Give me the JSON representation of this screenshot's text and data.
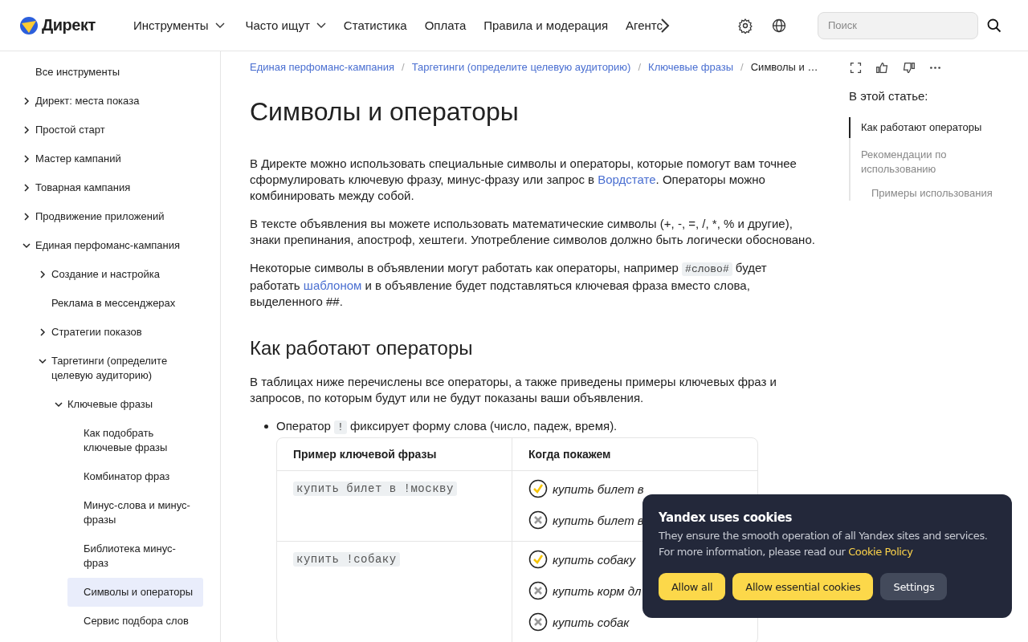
{
  "header": {
    "logo": "Директ",
    "nav": [
      {
        "label": "Инструменты",
        "dropdown": true
      },
      {
        "label": "Часто ищут",
        "dropdown": true
      },
      {
        "label": "Статистика",
        "dropdown": false
      },
      {
        "label": "Оплата",
        "dropdown": false
      },
      {
        "label": "Правила и модерация",
        "dropdown": false
      },
      {
        "label": "Агентс",
        "dropdown": false
      }
    ],
    "search": {
      "placeholder": "Поиск"
    }
  },
  "sidebar": {
    "items": [
      {
        "label": "Все инструменты",
        "kind": "page",
        "selected": false
      },
      {
        "label": "Директ: места показа",
        "kind": "folder",
        "expanded": false,
        "selected": false
      },
      {
        "label": "Простой старт",
        "kind": "folder",
        "expanded": false,
        "selected": false
      },
      {
        "label": "Мастер кампаний",
        "kind": "folder",
        "expanded": false,
        "selected": false
      },
      {
        "label": "Товарная кампания",
        "kind": "folder",
        "expanded": false,
        "selected": false
      },
      {
        "label": "Продвижение приложений",
        "kind": "folder",
        "expanded": false,
        "selected": false
      },
      {
        "label": "Единая перфоманс-кампания",
        "kind": "folder",
        "expanded": true,
        "selected": false,
        "children": [
          {
            "label": "Создание и настройка",
            "kind": "folder",
            "expanded": false,
            "selected": false
          },
          {
            "label": "Реклама в мессенджерах",
            "kind": "page",
            "selected": false
          },
          {
            "label": "Стратегии показов",
            "kind": "folder",
            "expanded": false,
            "selected": false
          },
          {
            "label": "Таргетинги (определите целевую аудиторию)",
            "kind": "folder",
            "expanded": true,
            "selected": false,
            "children": [
              {
                "label": "Ключевые фразы",
                "kind": "folder",
                "expanded": true,
                "selected": false,
                "children": [
                  {
                    "label": "Как подобрать ключевые фразы",
                    "kind": "page",
                    "selected": false
                  },
                  {
                    "label": "Комбинатор фраз",
                    "kind": "page",
                    "selected": false
                  },
                  {
                    "label": "Минус-слова и минус-фразы",
                    "kind": "page",
                    "selected": false
                  },
                  {
                    "label": "Библиотека минус-фраз",
                    "kind": "page",
                    "selected": false
                  },
                  {
                    "label": "Символы и операторы",
                    "kind": "page",
                    "selected": true
                  },
                  {
                    "label": "Сервис подбора слов",
                    "kind": "page",
                    "selected": false
                  }
                ]
              }
            ]
          }
        ]
      }
    ]
  },
  "breadcrumbs": {
    "separator": "/",
    "items": [
      {
        "label": "Единая перфоманс-кампания",
        "current": false
      },
      {
        "label": "Таргетинги (определите целевую аудиторию)",
        "current": false
      },
      {
        "label": "Ключевые фразы",
        "current": false
      },
      {
        "label": "Символы и …",
        "current": true
      }
    ]
  },
  "article": {
    "title": "Символы и операторы",
    "intro": [
      [
        {
          "kind": "text",
          "text": "В Директе можно использовать специальные символы и операторы, которые помогут вам точнее сформулировать ключевую фразу, минус-фразу или запрос в "
        },
        {
          "kind": "link",
          "text": "Вордстате"
        },
        {
          "kind": "text",
          "text": ". Операторы можно комбинировать между собой."
        }
      ],
      [
        {
          "kind": "text",
          "text": "В тексте объявления вы можете использовать математические символы (+, -, =, /, *, % и другие), знаки препинания, апостроф, хештеги. Употребление символов должно быть логически обосновано."
        }
      ],
      [
        {
          "kind": "text",
          "text": "Некоторые символы в объявлении могут работать как операторы, например "
        },
        {
          "kind": "code",
          "text": "#слово#"
        },
        {
          "kind": "text",
          "text": " будет работать "
        },
        {
          "kind": "link",
          "text": "шаблоном"
        },
        {
          "kind": "text",
          "text": " и в объявление будет подставляться ключевая фраза вместо слова, выделенного ##."
        }
      ]
    ],
    "section_title": "Как работают операторы",
    "section_text": "В таблицах ниже перечислены все операторы, а также приведены примеры ключевых фраз и запросов, по которым будут или не будут показаны ваши объявления.",
    "bullet": [
      {
        "kind": "text",
        "text": "Оператор "
      },
      {
        "kind": "code",
        "text": "!"
      },
      {
        "kind": "text",
        "text": " фиксирует форму слова (число, падеж, время)."
      }
    ],
    "table": {
      "columns": [
        "Пример ключевой фразы",
        "Когда покажем"
      ],
      "rows": [
        {
          "phrase": "купить билет в !москву",
          "results": [
            {
              "text": "купить билет в",
              "shown": true
            },
            {
              "text": "купить билет в",
              "shown": false
            }
          ]
        },
        {
          "phrase": "купить !собаку",
          "results": [
            {
              "text": "купить собаку",
              "shown": true
            },
            {
              "text": "купить корм дл",
              "shown": false
            },
            {
              "text": "купить собак",
              "shown": false
            }
          ]
        }
      ]
    }
  },
  "toc": {
    "title": "В этой статье:",
    "items": [
      {
        "label": "Как работают операторы",
        "selected": true
      },
      {
        "label": "Рекомендации по использованию",
        "selected": false,
        "children": [
          {
            "label": "Примеры использования",
            "selected": false
          }
        ]
      }
    ]
  },
  "cookie_banner": {
    "title": "Yandex uses cookies",
    "text": "They ensure the smooth operation of all Yandex sites and services. For more information, please read our ",
    "link": "Cookie Policy",
    "buttons": [
      {
        "label": "Allow all",
        "kind": "primary"
      },
      {
        "label": "Allow essential cookies",
        "kind": "primary"
      },
      {
        "label": "Settings",
        "kind": "secondary"
      }
    ]
  }
}
